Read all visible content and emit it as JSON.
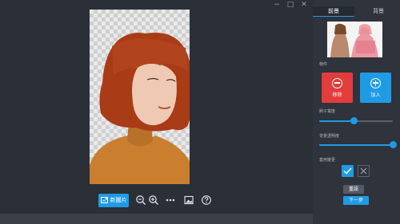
{
  "tabs": {
    "foreground": "前景",
    "background": "背景"
  },
  "panel": {
    "objects_label": "物件",
    "remove_label": "移除",
    "add_label": "加入",
    "brush_size_label": "刷子寬度",
    "brush_size_level": 0.47,
    "bg_opacity_label": "背景透明度",
    "bg_opacity_level": 1.0,
    "apply_label": "套用變更",
    "reset_label": "重設",
    "next_label": "下一步"
  },
  "toolbar": {
    "new_image_label": "新圖片",
    "icons": [
      "image-plus-icon",
      "zoom-out-icon",
      "zoom-in-icon",
      "more-icon",
      "image-icon",
      "help-icon"
    ]
  },
  "colors": {
    "accent": "#1f9be6",
    "remove": "#e23c3c",
    "panel_bg": "#2f333b",
    "canvas_bg": "#2b2f38"
  }
}
